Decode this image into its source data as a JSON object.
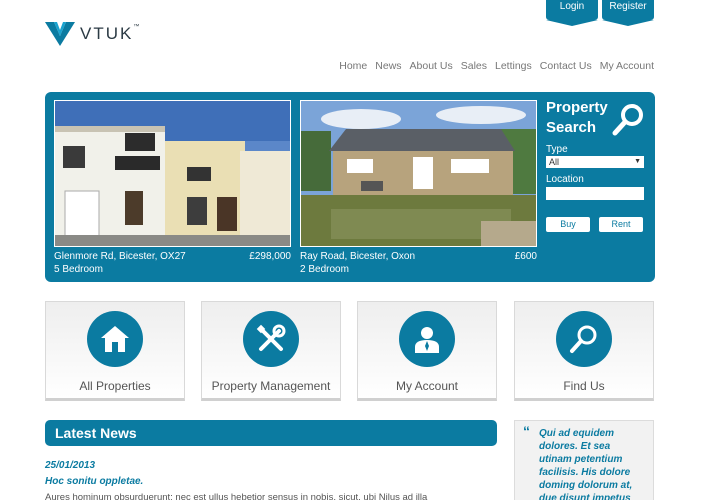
{
  "header": {
    "login_tab": "Login",
    "register_tab": "Register",
    "logo_text": "VTUK",
    "logo_tm": "™"
  },
  "nav": [
    "Home",
    "News",
    "About Us",
    "Sales",
    "Lettings",
    "Contact Us",
    "My Account"
  ],
  "hero": {
    "properties": [
      {
        "address": "Glenmore Rd, Bicester, OX27",
        "price": "£298,000",
        "bedrooms": "5 Bedroom"
      },
      {
        "address": "Ray Road, Bicester, Oxon",
        "price": "£600",
        "bedrooms": "2 Bedroom"
      }
    ],
    "search": {
      "title": "Property Search",
      "type_label": "Type",
      "type_value": "All",
      "location_label": "Location",
      "location_value": "",
      "buy_label": "Buy",
      "rent_label": "Rent"
    }
  },
  "cards": [
    {
      "label": "All Properties",
      "icon": "house-icon"
    },
    {
      "label": "Property Management",
      "icon": "tools-icon"
    },
    {
      "label": "My Account",
      "icon": "user-icon"
    },
    {
      "label": "Find Us",
      "icon": "magnifier-icon"
    }
  ],
  "news": {
    "title": "Latest News",
    "date": "25/01/2013",
    "headline": "Hoc sonitu oppletae.",
    "body": "Aures hominum obsurduerunt; nec est ullus hebetior sensus in nobis, sicut, ubi Nilus ad illa"
  },
  "quote": {
    "mark": "“",
    "text": "Qui ad equidem dolores. Et sea utinam petentium facilisis. His dolore doming dolorum at, due disunt impetus"
  },
  "colors": {
    "brand": "#0b7ba1"
  }
}
